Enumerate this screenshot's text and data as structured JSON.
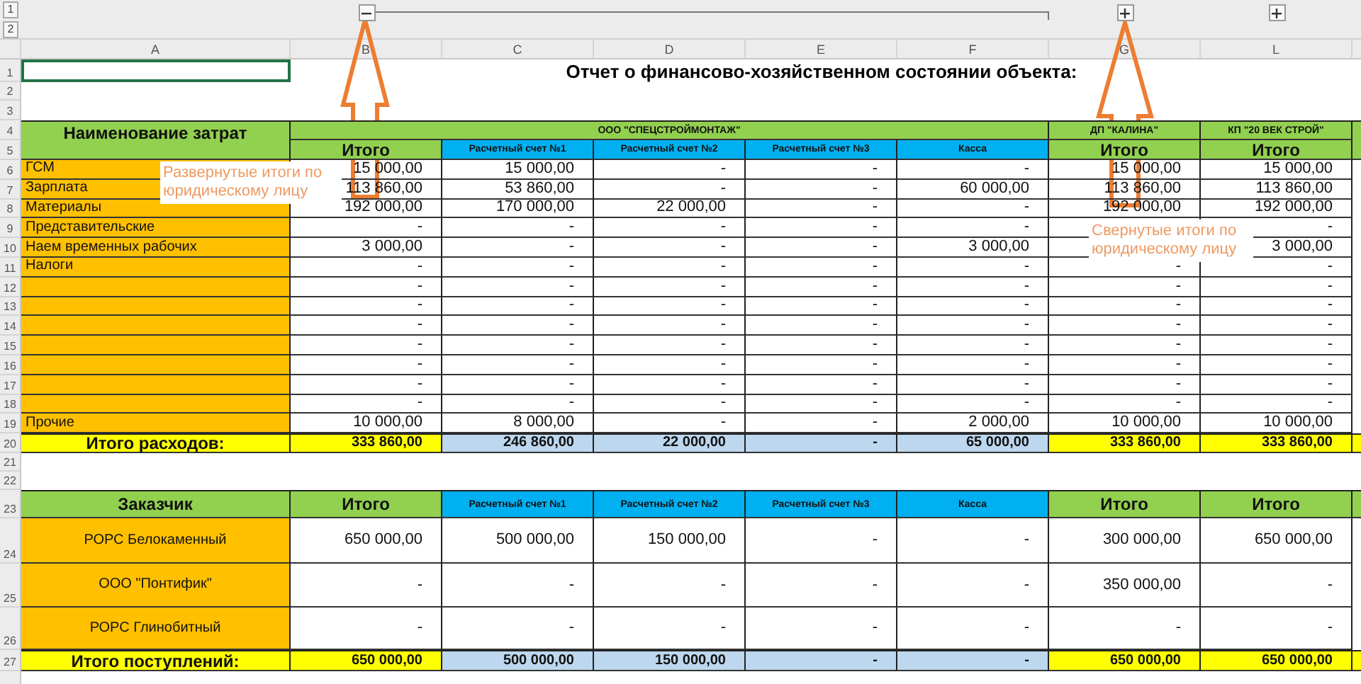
{
  "outline": {
    "levels": [
      "1",
      "2"
    ]
  },
  "column_headers": [
    "A",
    "B",
    "C",
    "D",
    "E",
    "F",
    "G",
    "L"
  ],
  "row_numbers": [
    "1",
    "2",
    "3",
    "4",
    "5",
    "6",
    "7",
    "8",
    "9",
    "10",
    "11",
    "12",
    "13",
    "14",
    "15",
    "16",
    "17",
    "18",
    "19",
    "20",
    "21",
    "22",
    "23",
    "24",
    "25",
    "26",
    "27"
  ],
  "title_row": {
    "a1_selected": true,
    "title": "Отчет о финансово-хозяйственном состоянии объекта:"
  },
  "expense_header": {
    "label": "Наименование затрат",
    "groups": [
      {
        "name": "ООО \"СПЕЦСТРОЙМОНТАЖ\"",
        "collapsed": false,
        "columns": [
          "Итого",
          "Расчетный счет №1",
          "Расчетный счет №2",
          "Расчетный счет №3",
          "Касса"
        ]
      },
      {
        "name": "ДП \"КАЛИНА\"",
        "collapsed": true,
        "columns": [
          "Итого"
        ]
      },
      {
        "name": "КП \"20 ВЕК СТРОЙ\"",
        "collapsed": true,
        "columns": [
          "Итого"
        ]
      }
    ]
  },
  "expenses": {
    "rows": [
      {
        "name": "ГСМ",
        "values": [
          "15 000,00",
          "15 000,00",
          "-",
          "-",
          "-",
          "15 000,00",
          "15 000,00"
        ]
      },
      {
        "name": "Зарплата",
        "values": [
          "113 860,00",
          "53 860,00",
          "-",
          "-",
          "60 000,00",
          "113 860,00",
          "113 860,00"
        ]
      },
      {
        "name": "Материалы",
        "values": [
          "192 000,00",
          "170 000,00",
          "22 000,00",
          "-",
          "-",
          "192 000,00",
          "192 000,00"
        ]
      },
      {
        "name": "Представительские",
        "values": {
          "B": "-",
          "C": "-",
          "D": "-",
          "E": "-",
          "F": "-",
          "L": "-"
        }
      },
      {
        "name": "Наем временных рабочих",
        "values": {
          "B": "3 000,00",
          "C": "-",
          "D": "-",
          "E": "-",
          "F": "3 000,00",
          "L": "3 000,00"
        }
      },
      {
        "name": "Налоги",
        "values": [
          "-",
          "-",
          "-",
          "-",
          "-",
          "-",
          "-"
        ]
      },
      {
        "values": [
          "-",
          "-",
          "-",
          "-",
          "-",
          "-",
          "-"
        ]
      },
      {
        "values": [
          "-",
          "-",
          "-",
          "-",
          "-",
          "-",
          "-"
        ]
      },
      {
        "values": [
          "-",
          "-",
          "-",
          "-",
          "-",
          "-",
          "-"
        ]
      },
      {
        "values": [
          "-",
          "-",
          "-",
          "-",
          "-",
          "-",
          "-"
        ]
      },
      {
        "values": [
          "-",
          "-",
          "-",
          "-",
          "-",
          "-",
          "-"
        ]
      },
      {
        "values": [
          "-",
          "-",
          "-",
          "-",
          "-",
          "-",
          "-"
        ]
      },
      {
        "values": [
          "-",
          "-",
          "-",
          "-",
          "-",
          "-",
          "-"
        ]
      },
      {
        "name": "Прочие",
        "values": [
          "10 000,00",
          "8 000,00",
          "-",
          "-",
          "2 000,00",
          "10 000,00",
          "10 000,00"
        ]
      }
    ],
    "total": {
      "label": "Итого расходов:",
      "values": [
        "333 860,00",
        "246 860,00",
        "22 000,00",
        "-",
        "65 000,00",
        "333 860,00",
        "333 860,00"
      ]
    }
  },
  "income": {
    "header": "Заказчик",
    "columns": [
      "Итого",
      "Расчетный счет №1",
      "Расчетный счет №2",
      "Расчетный счет №3",
      "Касса",
      "Итого",
      "Итого"
    ],
    "rows": [
      {
        "name": "РОРС Белокаменный",
        "values": [
          "650 000,00",
          "500 000,00",
          "150 000,00",
          "-",
          "-",
          "300 000,00",
          "650 000,00"
        ]
      },
      {
        "name": "ООО \"Понтифик\"",
        "values": [
          "-",
          "-",
          "-",
          "-",
          "-",
          "350 000,00",
          "-"
        ]
      },
      {
        "name": "РОРС Глинобитный",
        "values": [
          "-",
          "-",
          "-",
          "-",
          "-",
          "-",
          "-"
        ]
      }
    ],
    "total": {
      "label": "Итого поступлений:",
      "values": [
        "650 000,00",
        "500 000,00",
        "150 000,00",
        "-",
        "-",
        "650 000,00",
        "650 000,00"
      ]
    }
  },
  "annotations": [
    {
      "text": "Развернутые итоги по юридическому лицу"
    },
    {
      "text": "Свернутые итоги по юридическому лицу"
    }
  ]
}
